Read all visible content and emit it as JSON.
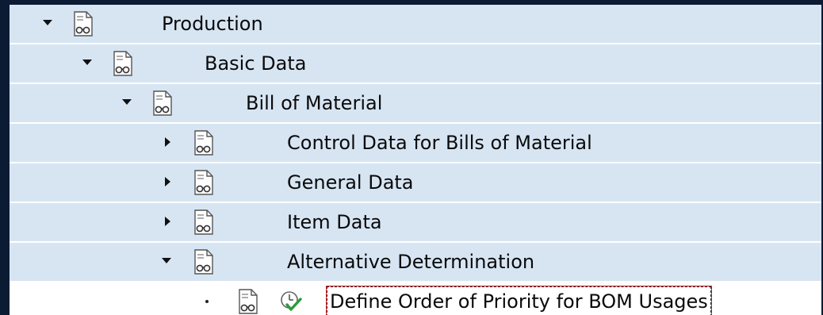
{
  "tree": {
    "nodes": [
      {
        "label": "Production",
        "state": "expanded",
        "icon": "img-doc-icon"
      },
      {
        "label": "Basic Data",
        "state": "expanded",
        "icon": "img-doc-icon"
      },
      {
        "label": "Bill of Material",
        "state": "expanded",
        "icon": "img-doc-icon"
      },
      {
        "label": "Control Data for Bills of Material",
        "state": "collapsed",
        "icon": "img-doc-icon"
      },
      {
        "label": "General Data",
        "state": "collapsed",
        "icon": "img-doc-icon"
      },
      {
        "label": "Item Data",
        "state": "collapsed",
        "icon": "img-doc-icon"
      },
      {
        "label": "Alternative Determination",
        "state": "expanded",
        "icon": "img-doc-icon"
      },
      {
        "label": "Define Order of Priority for BOM Usages",
        "state": "leaf",
        "icon": "img-doc-icon",
        "action_icon": "execute-clock-check-icon",
        "selected": true
      }
    ]
  },
  "colors": {
    "row_shade": "#d7e5f3",
    "row_white": "#ffffff",
    "focus_border": "#e0202a",
    "background": "#0b1b33"
  }
}
